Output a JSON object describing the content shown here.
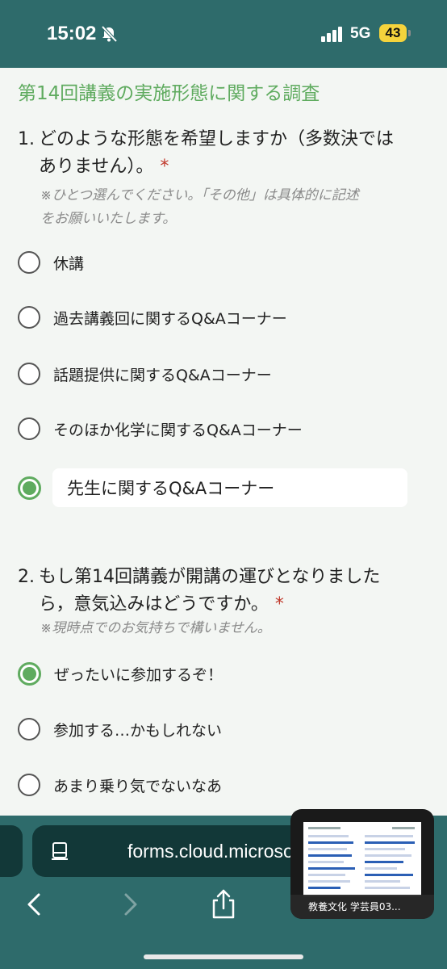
{
  "status_bar": {
    "time": "15:02",
    "network": "5G",
    "battery": "43"
  },
  "form": {
    "title": "第14回講義の実施形態に関する調査",
    "questions": [
      {
        "number": "1.",
        "text_line1": "どのような形態を希望しますか（多数決では",
        "text_line2": "ありません）。",
        "required": "*",
        "note_line1": "※ひとつ選んでください。「その他」は具体的に記述",
        "note_line2": "をお願いいたします。",
        "options": [
          {
            "label": "休講",
            "selected": false
          },
          {
            "label": "過去講義回に関するQ&Aコーナー",
            "selected": false
          },
          {
            "label": "話題提供に関するQ&Aコーナー",
            "selected": false
          },
          {
            "label": "そのほか化学に関するQ&Aコーナー",
            "selected": false
          },
          {
            "label": "先生に関するQ&Aコーナー",
            "selected": true
          }
        ]
      },
      {
        "number": "2.",
        "text_line1": "もし第14回講義が開講の運びとなりました",
        "text_line2": "ら，意気込みはどうですか。",
        "required": "*",
        "note_line1": "※現時点でのお気持ちで構いません。",
        "options": [
          {
            "label": "ぜったいに参加するぞ！",
            "selected": true
          },
          {
            "label": "参加する…かもしれない",
            "selected": false
          },
          {
            "label": "あまり乗り気でないなあ",
            "selected": false
          }
        ]
      }
    ]
  },
  "browser": {
    "url": "forms.cloud.microsoft",
    "pip_caption": "教養文化 学芸員03..."
  },
  "colors": {
    "accent": "#5fab5f",
    "chrome": "#2e6b6b",
    "required": "#c0392b"
  }
}
